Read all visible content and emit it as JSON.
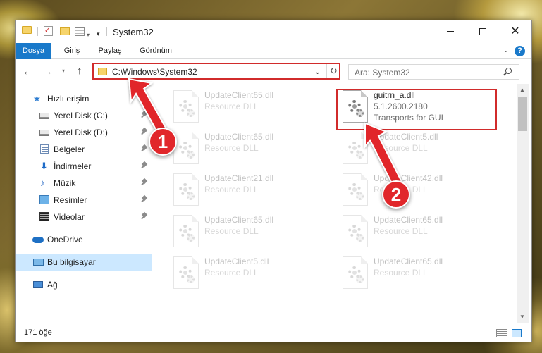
{
  "window": {
    "title": "System32"
  },
  "ribbon": {
    "tabs": [
      {
        "label": "Dosya",
        "active": true
      },
      {
        "label": "Giriş"
      },
      {
        "label": "Paylaş"
      },
      {
        "label": "Görünüm"
      }
    ],
    "help": "?"
  },
  "address": {
    "path": "C:\\Windows\\System32",
    "search_placeholder": "Ara: System32"
  },
  "sidebar": {
    "items": [
      {
        "label": "Hızlı erişim",
        "icon": "star-icon"
      },
      {
        "label": "Yerel Disk (C:)",
        "icon": "disk-icon",
        "pinned": true
      },
      {
        "label": "Yerel Disk (D:)",
        "icon": "disk-icon",
        "pinned": true
      },
      {
        "label": "Belgeler",
        "icon": "documents-icon",
        "pinned": true
      },
      {
        "label": "İndirmeler",
        "icon": "download-icon",
        "pinned": true
      },
      {
        "label": "Müzik",
        "icon": "music-icon",
        "pinned": true
      },
      {
        "label": "Resimler",
        "icon": "pictures-icon",
        "pinned": true
      },
      {
        "label": "Videolar",
        "icon": "video-icon",
        "pinned": true
      },
      {
        "label": "OneDrive",
        "icon": "cloud-icon"
      },
      {
        "label": "Bu bilgisayar",
        "icon": "computer-icon",
        "selected": true
      },
      {
        "label": "Ağ",
        "icon": "network-icon"
      }
    ]
  },
  "files": {
    "left": [
      {
        "name": "UpdateClient65.dll",
        "type": "Resource DLL"
      },
      {
        "name": "UpdateClient65.dll",
        "type": "Resource DLL"
      },
      {
        "name": "UpdateClient21.dll",
        "type": "Resource DLL"
      },
      {
        "name": "UpdateClient65.dll",
        "type": "Resource DLL"
      },
      {
        "name": "UpdateClient5.dll",
        "type": "Resource DLL"
      }
    ],
    "right_highlight": {
      "name": "guitrn_a.dll",
      "version": "5.1.2600.2180",
      "description": "Transports for GUI"
    },
    "right": [
      {
        "name": "UpdateClient5.dll",
        "type": "Resource DLL"
      },
      {
        "name": "UpdateClient42.dll",
        "type": "Resource DLL"
      },
      {
        "name": "UpdateClient65.dll",
        "type": "Resource DLL"
      },
      {
        "name": "UpdateClient65.dll",
        "type": "Resource DLL"
      }
    ]
  },
  "status": {
    "count": "171 öğe"
  },
  "annotations": {
    "step1": "1",
    "step2": "2",
    "color": "#e1272b"
  }
}
